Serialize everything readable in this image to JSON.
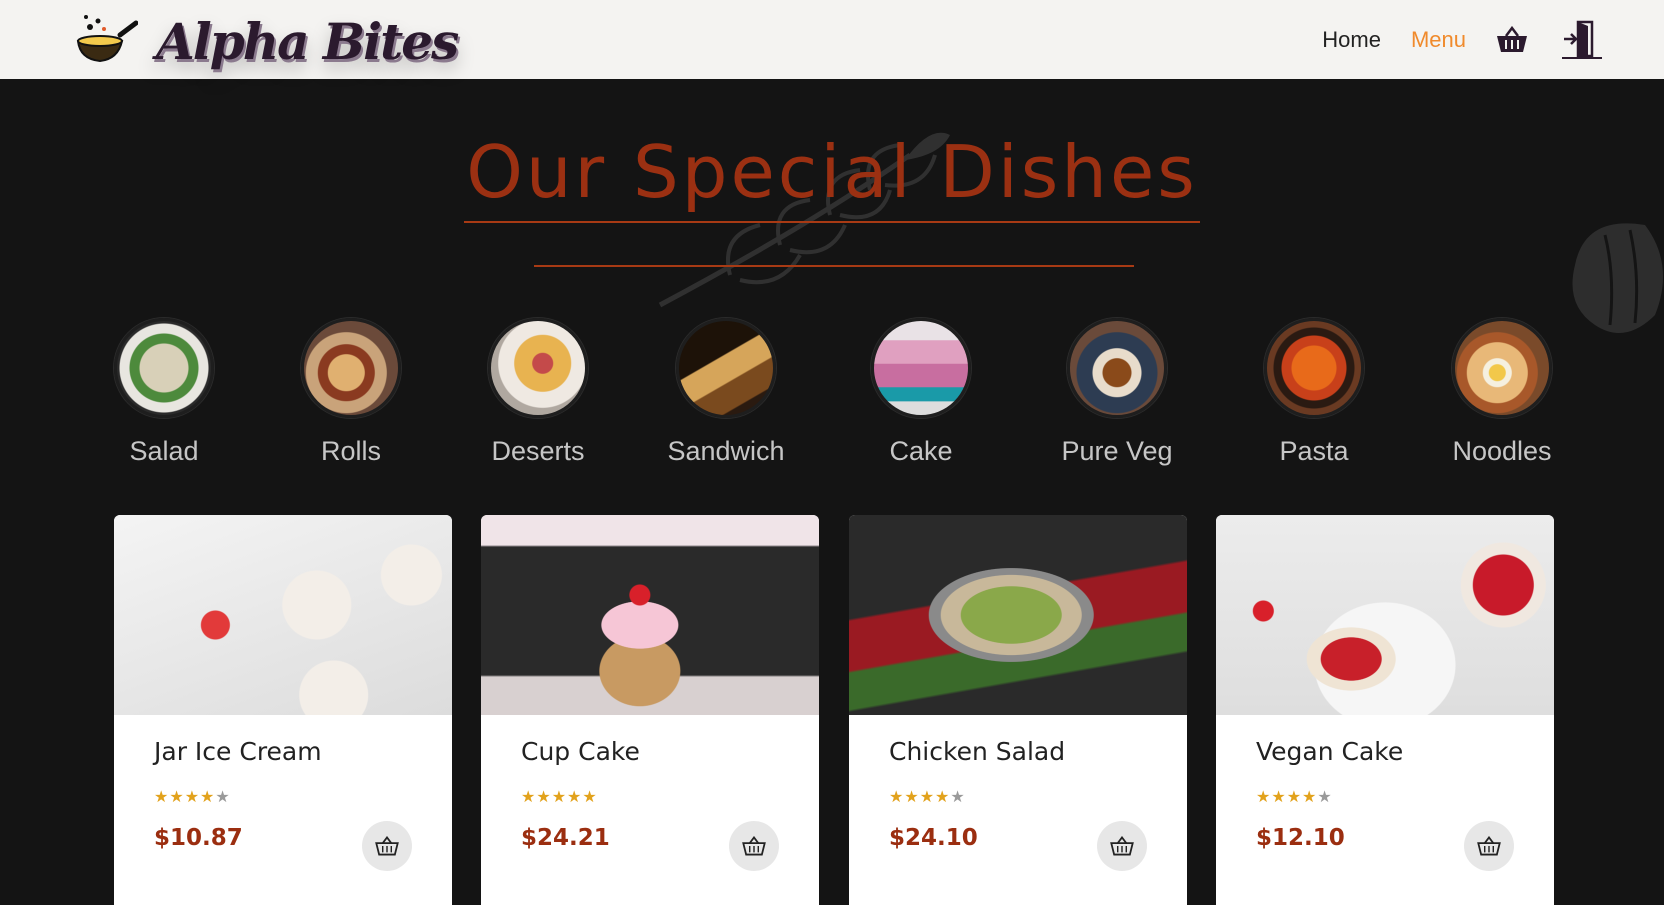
{
  "brand": {
    "name": "Alpha Bites"
  },
  "nav": {
    "home_label": "Home",
    "menu_label": "Menu",
    "cart_icon": "basket-icon",
    "logout_icon": "logout-door-icon"
  },
  "heading": {
    "title": "Our Special Dishes"
  },
  "categories": [
    {
      "label": "Salad"
    },
    {
      "label": "Rolls"
    },
    {
      "label": "Deserts"
    },
    {
      "label": "Sandwich"
    },
    {
      "label": "Cake"
    },
    {
      "label": "Pure Veg"
    },
    {
      "label": "Pasta"
    },
    {
      "label": "Noodles"
    }
  ],
  "dishes": [
    {
      "name": "Jar Ice Cream",
      "rating": 4,
      "price": "$10.87"
    },
    {
      "name": "Cup Cake",
      "rating": 5,
      "price": "$24.21"
    },
    {
      "name": "Chicken Salad",
      "rating": 4,
      "price": "$24.10"
    },
    {
      "name": "Vegan Cake",
      "rating": 4,
      "price": "$12.10"
    }
  ],
  "colors": {
    "background": "#141414",
    "header": "#f4f3f1",
    "accent_nav": "#f08a2c",
    "heading": "#9b3012",
    "price": "#9b2e10",
    "star": "#e2a21c"
  }
}
